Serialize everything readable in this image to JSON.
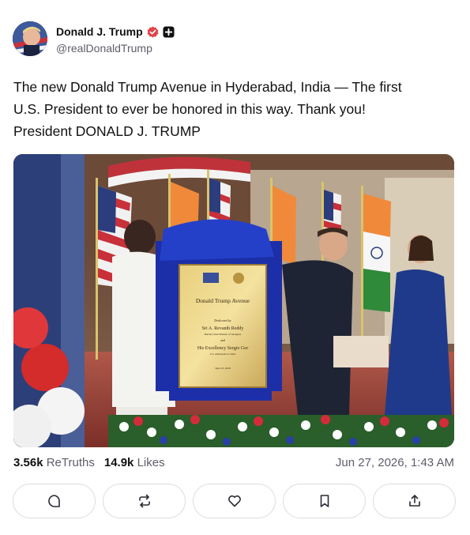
{
  "author": {
    "display_name": "Donald J. Trump",
    "handle": "@realDonaldTrump",
    "verified_icon": "verified-badge-icon",
    "plus_icon": "plus-badge-icon"
  },
  "post": {
    "text_lines": [
      "The new Donald Trump Avenue in Hyderabad, India — The first",
      "U.S. President to ever be honored in this way. Thank you!",
      "President DONALD J. TRUMP"
    ]
  },
  "plaque": {
    "title": "Donald Trump Avenue",
    "dedicated_by": "Dedicated by",
    "name1": "Sri A. Revanth Reddy",
    "name1_role": "Hon'ble Chief Minister of Telangana",
    "and": "and",
    "name2": "His Excellency Sergio Gor",
    "name2_role": "U.S. Ambassador to India",
    "date": "June 23, 2026"
  },
  "stats": {
    "retruths_count": "3.56k",
    "retruths_label": "ReTruths",
    "likes_count": "14.9k",
    "likes_label": "Likes",
    "timestamp": "Jun 27, 2026, 1:43 AM"
  },
  "actions": [
    {
      "name": "reply-button",
      "icon": "comment-icon"
    },
    {
      "name": "retruth-button",
      "icon": "repost-icon"
    },
    {
      "name": "like-button",
      "icon": "heart-icon"
    },
    {
      "name": "bookmark-button",
      "icon": "bookmark-icon"
    },
    {
      "name": "share-button",
      "icon": "share-icon"
    }
  ],
  "colors": {
    "verified": "#e0454a",
    "text_secondary": "#5e5e6b",
    "border": "#dcdce3"
  }
}
